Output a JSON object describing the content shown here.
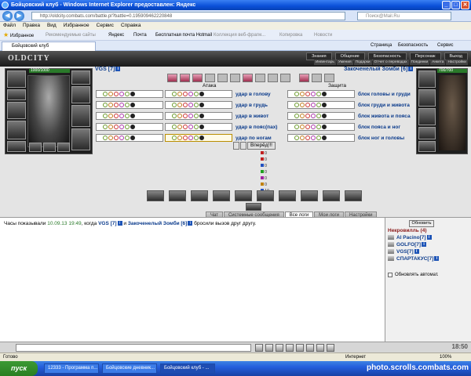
{
  "window": {
    "title": "Бойцовский клуб - Windows Internet Explorer предоставлен: Яндекс"
  },
  "address_bar": {
    "url": "http://oldcity.combats.com/battle.pl?battle=0.195909462220848",
    "search": "Поиск@Mail.Ru"
  },
  "menu": [
    "Файл",
    "Правка",
    "Вид",
    "Избранное",
    "Сервис",
    "Справка"
  ],
  "favorites_bar": {
    "label": "Избранное",
    "items": [
      "Рекомендуемые сайты",
      "Яндекс",
      "Почта",
      "Бесплатная почта Hotmail",
      "Коллекция веб-фрагм...",
      "Копировка",
      "Новости"
    ]
  },
  "tab": {
    "label": "Бойцовский клуб"
  },
  "ie_tools": [
    "Страница",
    "Безопасность",
    "Сервис"
  ],
  "game": {
    "logo": "OLDCITY",
    "nav_top": [
      "Знания",
      "Общение",
      "Безопасность",
      "Персонаж",
      "Выход"
    ],
    "nav_sub": [
      "Инвентарь",
      "Умения",
      "Подарки",
      "Отчет о переводах",
      "Поединки",
      "Анкета",
      "Настройки"
    ],
    "player": {
      "name": "VGS",
      "level": "[7]",
      "hp": "1000/1000"
    },
    "enemy": {
      "name": "Закоченелый Зомби",
      "level": "[6]",
      "hp": "700/700"
    },
    "attack_header": "Атака",
    "defense_header": "Защита",
    "attack_labels": [
      "удар в голову",
      "удар в грудь",
      "удар в живот",
      "удар в пояс(пах)",
      "удар по ногам"
    ],
    "block_labels": [
      "блок головы и груди",
      "блок груди и живота",
      "блок живота и пояса",
      "блок пояса и ног",
      "блок ног и головы"
    ],
    "forward_button": "Вперёд!!!",
    "stats": [
      "0",
      "0",
      "0",
      "0",
      "0",
      "0",
      "10"
    ],
    "stat_colors": [
      "#c02020",
      "#c02020",
      "#2050c0",
      "#20a020",
      "#a020a0",
      "#c08000",
      "#2050c0"
    ]
  },
  "bottom_tabs": [
    "Чат",
    "Системные сообщения",
    "Все логи",
    "Мои логи",
    "Настройки"
  ],
  "chat": {
    "prefix": "Часы показывали",
    "time": "10.09.13 19:49",
    "mid": ", когда",
    "nick1": "VGS [7]",
    "and": "и",
    "nick2": "Закоченелый Зомби [6]",
    "suffix": "бросили вызов друг другу."
  },
  "sidebar": {
    "refresh": "Обновить",
    "location": "Некровилль (4)",
    "users": [
      "Al Pacino[7]",
      "GOLFO[7]",
      "VGS[7]",
      "СПАРТАКУС[7]"
    ],
    "auto_refresh": "Обновлять автомат."
  },
  "clock": "18:50",
  "status": {
    "left": "Готово",
    "zone": "Интернет",
    "zoom": "100%"
  },
  "taskbar": {
    "start": "пуск",
    "items": [
      "12333 - Программа п...",
      "Бойцовские дневник...",
      "Бойцовский клуб - ..."
    ]
  },
  "watermark": "photo.scrolls.combats.com"
}
